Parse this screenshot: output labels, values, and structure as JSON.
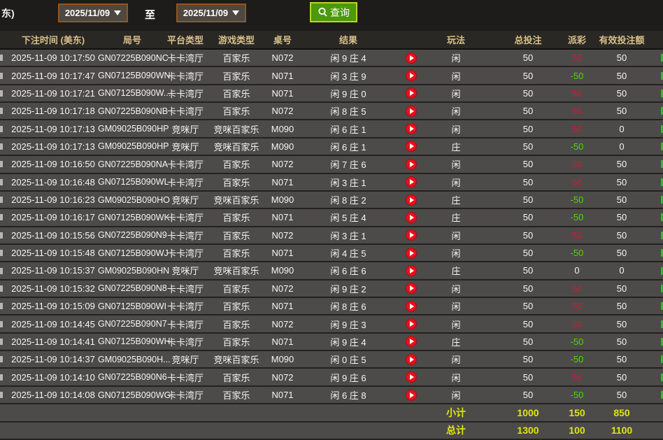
{
  "toolbar": {
    "cutoff_label": "东)",
    "date_from": "2025/11/09",
    "to_label": "至",
    "date_to": "2025/11/09",
    "query_label": "查询"
  },
  "colors": {
    "header_text": "#d9bf8b",
    "payout_win_red": "#d21737",
    "payout_loss_green": "#52d800",
    "totals_yellow": "#dfe513",
    "query_button_green": "#4a9a0a",
    "datebox_border_brown": "#95551c",
    "row_background": "#4c4b49"
  },
  "table": {
    "headers": {
      "time": "下注时间 (美东)",
      "round": "局号",
      "platform": "平台类型",
      "game": "游戏类型",
      "table_no": "桌号",
      "result": "结果",
      "play": "玩法",
      "bet": "总投注",
      "payout": "派彩",
      "valid": "有效投注额"
    },
    "rows": [
      {
        "time": "2025-11-09 10:17:50",
        "round": "GN07225B090NC",
        "platform": "卡卡湾厅",
        "game": "百家乐",
        "table_no": "N072",
        "result": "闲 9 庄 4",
        "play": "闲",
        "bet": "50",
        "payout": "50",
        "payout_class": "pos",
        "valid": "50"
      },
      {
        "time": "2025-11-09 10:17:47",
        "round": "GN07125B090WN",
        "platform": "卡卡湾厅",
        "game": "百家乐",
        "table_no": "N071",
        "result": "闲 3 庄 9",
        "play": "闲",
        "bet": "50",
        "payout": "-50",
        "payout_class": "neg",
        "valid": "50"
      },
      {
        "time": "2025-11-09 10:17:21",
        "round": "GN07125B090W...",
        "platform": "卡卡湾厅",
        "game": "百家乐",
        "table_no": "N071",
        "result": "闲 9 庄 0",
        "play": "闲",
        "bet": "50",
        "payout": "50",
        "payout_class": "pos",
        "valid": "50"
      },
      {
        "time": "2025-11-09 10:17:18",
        "round": "GN07225B090NB",
        "platform": "卡卡湾厅",
        "game": "百家乐",
        "table_no": "N072",
        "result": "闲 8 庄 5",
        "play": "闲",
        "bet": "50",
        "payout": "50",
        "payout_class": "pos",
        "valid": "50"
      },
      {
        "time": "2025-11-09 10:17:13",
        "round": "GM09025B090HP",
        "platform": "竞咪厅",
        "game": "竞咪百家乐",
        "table_no": "M090",
        "result": "闲 6 庄 1",
        "play": "闲",
        "bet": "50",
        "payout": "50",
        "payout_class": "pos",
        "valid": "0"
      },
      {
        "time": "2025-11-09 10:17:13",
        "round": "GM09025B090HP",
        "platform": "竞咪厅",
        "game": "竞咪百家乐",
        "table_no": "M090",
        "result": "闲 6 庄 1",
        "play": "庄",
        "bet": "50",
        "payout": "-50",
        "payout_class": "neg",
        "valid": "0"
      },
      {
        "time": "2025-11-09 10:16:50",
        "round": "GN07225B090NA",
        "platform": "卡卡湾厅",
        "game": "百家乐",
        "table_no": "N072",
        "result": "闲 7 庄 6",
        "play": "闲",
        "bet": "50",
        "payout": "50",
        "payout_class": "pos",
        "valid": "50"
      },
      {
        "time": "2025-11-09 10:16:48",
        "round": "GN07125B090WL",
        "platform": "卡卡湾厅",
        "game": "百家乐",
        "table_no": "N071",
        "result": "闲 3 庄 1",
        "play": "闲",
        "bet": "50",
        "payout": "50",
        "payout_class": "pos",
        "valid": "50"
      },
      {
        "time": "2025-11-09 10:16:23",
        "round": "GM09025B090HO",
        "platform": "竞咪厅",
        "game": "竞咪百家乐",
        "table_no": "M090",
        "result": "闲 8 庄 2",
        "play": "庄",
        "bet": "50",
        "payout": "-50",
        "payout_class": "neg",
        "valid": "50"
      },
      {
        "time": "2025-11-09 10:16:17",
        "round": "GN07125B090WK",
        "platform": "卡卡湾厅",
        "game": "百家乐",
        "table_no": "N071",
        "result": "闲 5 庄 4",
        "play": "庄",
        "bet": "50",
        "payout": "-50",
        "payout_class": "neg",
        "valid": "50"
      },
      {
        "time": "2025-11-09 10:15:56",
        "round": "GN07225B090N9",
        "platform": "卡卡湾厅",
        "game": "百家乐",
        "table_no": "N072",
        "result": "闲 3 庄 1",
        "play": "闲",
        "bet": "50",
        "payout": "50",
        "payout_class": "pos",
        "valid": "50"
      },
      {
        "time": "2025-11-09 10:15:48",
        "round": "GN07125B090WJ",
        "platform": "卡卡湾厅",
        "game": "百家乐",
        "table_no": "N071",
        "result": "闲 4 庄 5",
        "play": "闲",
        "bet": "50",
        "payout": "-50",
        "payout_class": "neg",
        "valid": "50"
      },
      {
        "time": "2025-11-09 10:15:37",
        "round": "GM09025B090HN",
        "platform": "竞咪厅",
        "game": "竞咪百家乐",
        "table_no": "M090",
        "result": "闲 6 庄 6",
        "play": "庄",
        "bet": "50",
        "payout": "0",
        "payout_class": "zero",
        "valid": "0"
      },
      {
        "time": "2025-11-09 10:15:32",
        "round": "GN07225B090N8",
        "platform": "卡卡湾厅",
        "game": "百家乐",
        "table_no": "N072",
        "result": "闲 9 庄 2",
        "play": "闲",
        "bet": "50",
        "payout": "50",
        "payout_class": "pos",
        "valid": "50"
      },
      {
        "time": "2025-11-09 10:15:09",
        "round": "GN07125B090WI",
        "platform": "卡卡湾厅",
        "game": "百家乐",
        "table_no": "N071",
        "result": "闲 8 庄 6",
        "play": "闲",
        "bet": "50",
        "payout": "50",
        "payout_class": "pos",
        "valid": "50"
      },
      {
        "time": "2025-11-09 10:14:45",
        "round": "GN07225B090N7",
        "platform": "卡卡湾厅",
        "game": "百家乐",
        "table_no": "N072",
        "result": "闲 9 庄 3",
        "play": "闲",
        "bet": "50",
        "payout": "50",
        "payout_class": "pos",
        "valid": "50"
      },
      {
        "time": "2025-11-09 10:14:41",
        "round": "GN07125B090WH",
        "platform": "卡卡湾厅",
        "game": "百家乐",
        "table_no": "N071",
        "result": "闲 9 庄 4",
        "play": "庄",
        "bet": "50",
        "payout": "-50",
        "payout_class": "neg",
        "valid": "50"
      },
      {
        "time": "2025-11-09 10:14:37",
        "round": "GM09025B090H...",
        "platform": "竞咪厅",
        "game": "竞咪百家乐",
        "table_no": "M090",
        "result": "闲 0 庄 5",
        "play": "闲",
        "bet": "50",
        "payout": "-50",
        "payout_class": "neg",
        "valid": "50"
      },
      {
        "time": "2025-11-09 10:14:10",
        "round": "GN07225B090N6",
        "platform": "卡卡湾厅",
        "game": "百家乐",
        "table_no": "N072",
        "result": "闲 9 庄 6",
        "play": "闲",
        "bet": "50",
        "payout": "50",
        "payout_class": "pos",
        "valid": "50"
      },
      {
        "time": "2025-11-09 10:14:08",
        "round": "GN07125B090WG",
        "platform": "卡卡湾厅",
        "game": "百家乐",
        "table_no": "N071",
        "result": "闲 6 庄 8",
        "play": "闲",
        "bet": "50",
        "payout": "-50",
        "payout_class": "neg",
        "valid": "50"
      }
    ],
    "subtotal": {
      "label": "小计",
      "bet": "1000",
      "payout": "150",
      "valid": "850"
    },
    "total": {
      "label": "总计",
      "bet": "1300",
      "payout": "100",
      "valid": "1100"
    }
  }
}
